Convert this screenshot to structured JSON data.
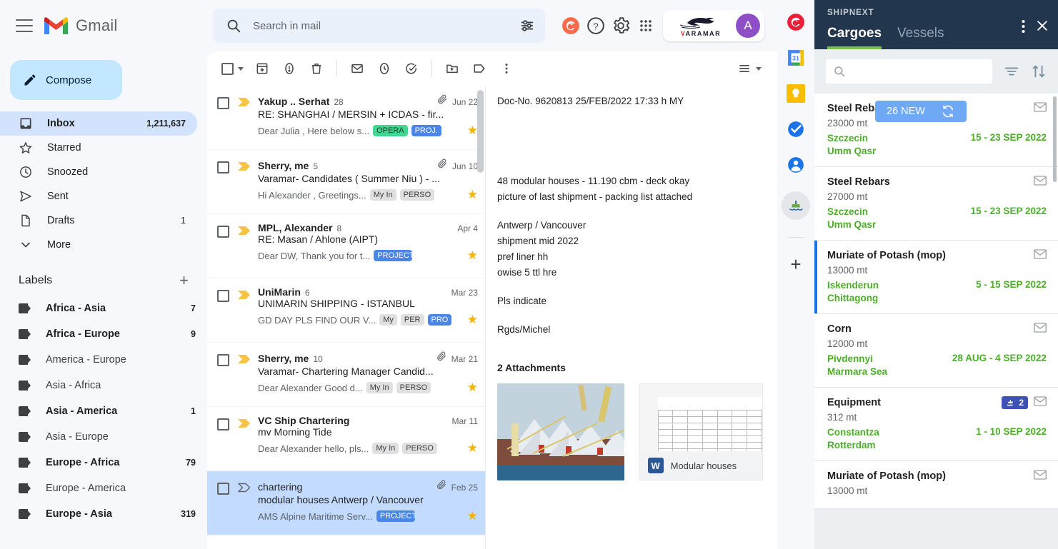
{
  "brand": {
    "app_name": "Gmail"
  },
  "compose": {
    "label": "Compose"
  },
  "nav": {
    "items": [
      {
        "label": "Inbox",
        "count": "1,211,637",
        "icon": "inbox-icon",
        "active": true
      },
      {
        "label": "Starred",
        "count": "",
        "icon": "star-icon",
        "active": false
      },
      {
        "label": "Snoozed",
        "count": "",
        "icon": "clock-icon",
        "active": false
      },
      {
        "label": "Sent",
        "count": "",
        "icon": "send-icon",
        "active": false
      },
      {
        "label": "Drafts",
        "count": "1",
        "icon": "draft-icon",
        "active": false
      },
      {
        "label": "More",
        "count": "",
        "icon": "chevron-down-icon",
        "active": false
      }
    ]
  },
  "labels": {
    "title": "Labels",
    "add": "+",
    "items": [
      {
        "label": "Africa - Asia",
        "count": "7",
        "bold": true
      },
      {
        "label": "Africa - Europe",
        "count": "9",
        "bold": true
      },
      {
        "label": "America - Europe",
        "count": "",
        "bold": false
      },
      {
        "label": "Asia - Africa",
        "count": "",
        "bold": false
      },
      {
        "label": "Asia - America",
        "count": "1",
        "bold": true
      },
      {
        "label": "Asia - Europe",
        "count": "",
        "bold": false
      },
      {
        "label": "Europe - Africa",
        "count": "79",
        "bold": true
      },
      {
        "label": "Europe - America",
        "count": "",
        "bold": false
      },
      {
        "label": "Europe - Asia",
        "count": "319",
        "bold": true
      }
    ]
  },
  "search": {
    "placeholder": "Search in mail",
    "value": ""
  },
  "header": {
    "icons": [
      "search-icon",
      "tune-icon",
      "grammarly-icon",
      "help-icon",
      "settings-icon",
      "apps-grid-icon"
    ],
    "account_logo_text": "VARAMAR",
    "avatar_letter": "A"
  },
  "toolbar": {
    "icons": [
      "select-all-checkbox",
      "archive-icon",
      "report-spam-icon",
      "delete-icon",
      "mark-unread-icon",
      "snooze-icon",
      "add-to-tasks-icon",
      "move-to-icon",
      "labels-icon",
      "more-options-icon",
      "display-density-icon"
    ]
  },
  "maillist": {
    "rows": [
      {
        "from": "Yakup .. Serhat",
        "count": "28",
        "date": "Jun 22",
        "attachment": true,
        "subject": "RE: SHANGHAI / MERSIN + ICDAS - fir...",
        "snippet": "Dear Julia , Here below s...",
        "chips": [
          {
            "text": "OPERA",
            "style": "green"
          },
          {
            "text": "PROJ.",
            "style": "blue"
          }
        ],
        "starred": true,
        "selected": false,
        "unread": true
      },
      {
        "from": "Sherry, me",
        "count": "5",
        "date": "Jun 10",
        "attachment": true,
        "subject": "Varamar- Candidates ( Summer Niu ) - ...",
        "snippet": "Hi Alexander , Greetings...",
        "chips": [
          {
            "text": "My In",
            "style": "grey"
          },
          {
            "text": "PERSO",
            "style": "grey"
          }
        ],
        "starred": true,
        "selected": false,
        "unread": true
      },
      {
        "from": "MPL, Alexander",
        "count": "8",
        "date": "Apr 4",
        "attachment": false,
        "subject": "RE: Masan / Ahlone (AIPT)",
        "snippet": "Dear DW, Thank you for t...",
        "chips": [
          {
            "text": "PROJECTS",
            "style": "blue"
          }
        ],
        "starred": true,
        "selected": false,
        "unread": true
      },
      {
        "from": "UniMarin",
        "count": "6",
        "date": "Mar 23",
        "attachment": false,
        "subject": "UNIMARIN SHIPPING - ISTANBUL",
        "snippet": "GD DAY PLS FIND OUR V...",
        "chips": [
          {
            "text": "My",
            "style": "grey"
          },
          {
            "text": "PER",
            "style": "grey"
          },
          {
            "text": "PRO",
            "style": "blue"
          }
        ],
        "starred": true,
        "selected": false,
        "unread": true
      },
      {
        "from": "Sherry, me",
        "count": "10",
        "date": "Mar 21",
        "attachment": true,
        "subject": "Varamar- Chartering Manager Candid...",
        "snippet": "Dear Alexander Good d...",
        "chips": [
          {
            "text": "My In",
            "style": "grey"
          },
          {
            "text": "PERSO",
            "style": "grey"
          }
        ],
        "starred": true,
        "selected": false,
        "unread": true
      },
      {
        "from": "VC Ship Chartering",
        "count": "",
        "date": "Mar 11",
        "attachment": false,
        "subject": "mv Morning Tide",
        "snippet": "Dear Alexander hello, pls...",
        "chips": [
          {
            "text": "My In",
            "style": "grey"
          },
          {
            "text": "PERSO",
            "style": "grey"
          }
        ],
        "starred": true,
        "selected": false,
        "unread": true
      },
      {
        "from": "chartering",
        "count": "",
        "date": "Feb 25",
        "attachment": true,
        "subject": "modular houses Antwerp / Vancouver",
        "snippet": "AMS Alpine Maritime Serv...",
        "chips": [
          {
            "text": "PROJECTS",
            "style": "blue"
          }
        ],
        "starred": true,
        "selected": true,
        "unread": false
      }
    ]
  },
  "reading": {
    "doc_line": "Doc-No. 9620813  25/FEB/2022  17:33 h  MY",
    "body_para1_line1": "48 modular houses - 11.190 cbm - deck okay",
    "body_para1_line2": "picture of last shipment - packing list attached",
    "body_para2_line1": "Antwerp / Vancouver",
    "body_para2_line2": "shipment mid 2022",
    "body_para2_line3": "pref liner hh",
    "body_para2_line4": "owise 5 ttl hre",
    "body_para3": "Pls indicate",
    "signature": "Rgds/Michel",
    "attachments_title": "2 Attachments",
    "attachments": [
      {
        "name": "",
        "type": "image",
        "alt": "photo-modular-houses-on-deck"
      },
      {
        "name": "Modular houses",
        "type": "word",
        "icon": "word-icon"
      }
    ]
  },
  "rail": {
    "icons": [
      {
        "name": "grammarly-icon",
        "color": "#ea1f38"
      },
      {
        "name": "google-calendar-icon",
        "color": "#1a73e8"
      },
      {
        "name": "google-keep-icon",
        "color": "#fbbc04"
      },
      {
        "name": "google-tasks-icon",
        "color": "#1a73e8"
      },
      {
        "name": "google-contacts-icon",
        "color": "#1a73e8"
      },
      {
        "name": "shipnext-addon-icon",
        "color": "#4caf28"
      }
    ],
    "add_label": "+"
  },
  "shipnext": {
    "title": "SHIPNEXT",
    "tabs": [
      {
        "label": "Cargoes",
        "active": true
      },
      {
        "label": "Vessels",
        "active": false
      }
    ],
    "accent_color": "#7cc043",
    "header_color": "#22364e",
    "search_placeholder": "",
    "search_value": "",
    "new_pill": {
      "label": "26 NEW",
      "icon": "refresh-icon"
    },
    "cards": [
      {
        "title": "Steel Rebars",
        "qty": "23000 mt",
        "port_from": "Szczecin",
        "port_to": "Umm Qasr",
        "dates": "15 - 23 SEP 2022",
        "badge": "",
        "mail_icon": "mail-icon",
        "highlight": false
      },
      {
        "title": "Steel Rebars",
        "qty": "27000 mt",
        "port_from": "Szczecin",
        "port_to": "Umm Qasr",
        "dates": "15 - 23 SEP 2022",
        "badge": "",
        "mail_icon": "mail-icon",
        "highlight": false
      },
      {
        "title": "Muriate of Potash (mop)",
        "qty": "13000 mt",
        "port_from": "Iskenderun",
        "port_to": "Chittagong",
        "dates": "5 - 15 SEP 2022",
        "badge": "",
        "mail_icon": "mail-icon",
        "highlight": true
      },
      {
        "title": "Corn",
        "qty": "12000 mt",
        "port_from": "Pivdennyi",
        "port_to": "Marmara Sea",
        "dates": "28 AUG - 4 SEP 2022",
        "badge": "",
        "mail_icon": "mail-icon",
        "highlight": false
      },
      {
        "title": "Equipment",
        "qty": "312 mt",
        "port_from": "Constantza",
        "port_to": "Rotterdam",
        "dates": "1 - 10 SEP 2022",
        "badge": "2",
        "mail_icon": "mail-icon",
        "highlight": false
      },
      {
        "title": "Muriate of Potash (mop)",
        "qty": "13000 mt",
        "port_from": "",
        "port_to": "",
        "dates": "",
        "badge": "",
        "mail_icon": "mail-icon",
        "highlight": false
      }
    ]
  }
}
